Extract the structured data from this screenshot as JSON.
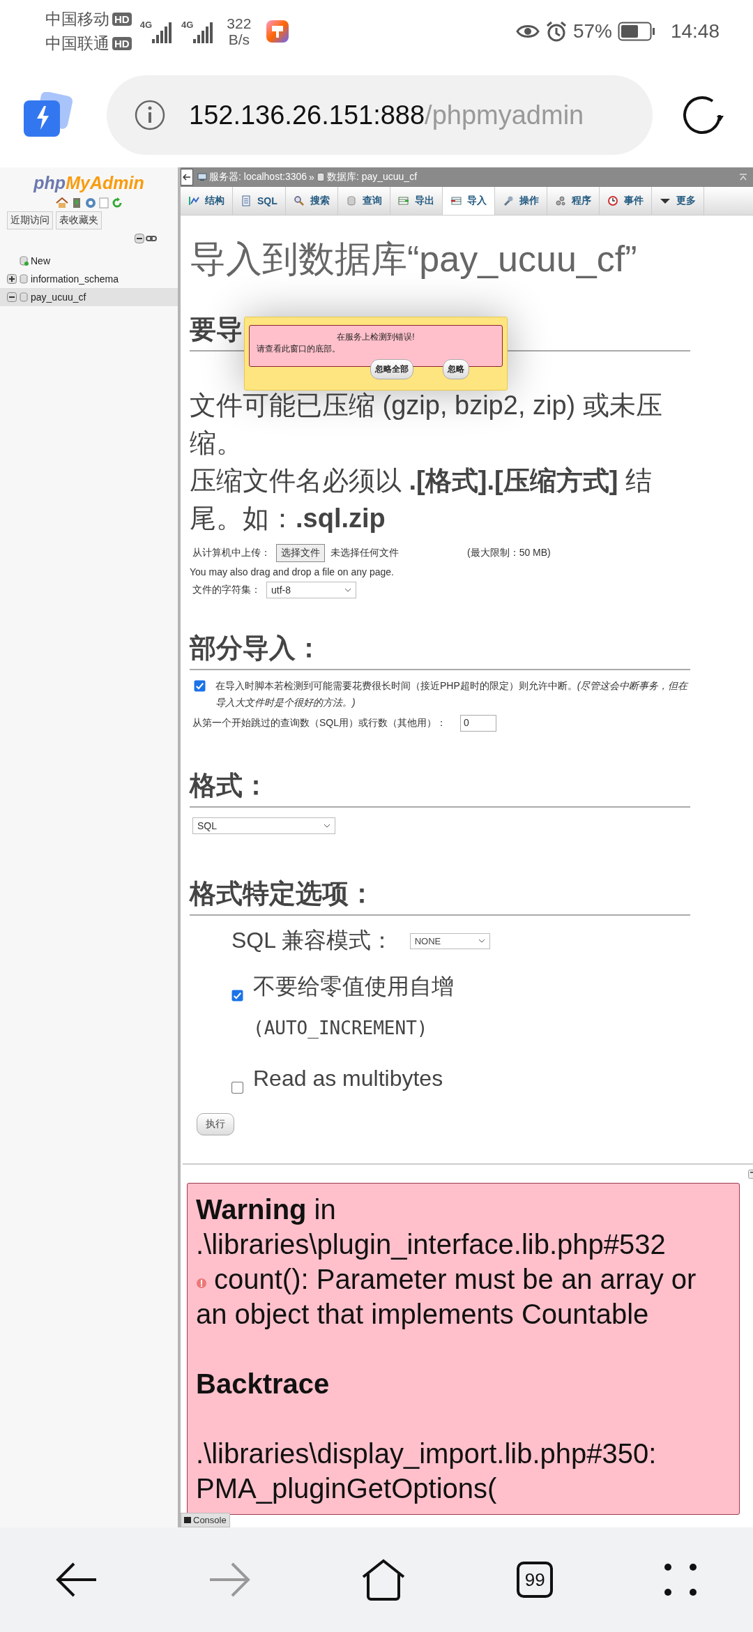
{
  "status_bar": {
    "carrier_1": "中国移动",
    "carrier_2": "中国联通",
    "hd_1": "HD",
    "hd_2": "HD",
    "network_1": "4G",
    "network_2": "4G",
    "speed": "322",
    "speed_unit": "B/s",
    "battery": "57%",
    "time": "14:48"
  },
  "url_bar": {
    "host": "152.136.26.151:888",
    "path": "/phpmyadmin"
  },
  "sidebar": {
    "logo_php": "php",
    "logo_myadmin": "MyAdmin",
    "buttons": [
      "近期访问",
      "表收藏夹"
    ],
    "tree": [
      {
        "kind": "new",
        "label": "New",
        "selected": false
      },
      {
        "kind": "database",
        "label": "information_schema",
        "expanded": false,
        "selected": false
      },
      {
        "kind": "database",
        "label": "pay_ucuu_cf",
        "expanded": true,
        "selected": true
      }
    ]
  },
  "breadcrumb": {
    "server": "服务器: localhost:3306",
    "separator": "»",
    "database": "数据库: pay_ucuu_cf"
  },
  "tabs": [
    {
      "label": "结构",
      "selected": false
    },
    {
      "label": "SQL",
      "selected": false
    },
    {
      "label": "搜索",
      "selected": false
    },
    {
      "label": "查询",
      "selected": false
    },
    {
      "label": "导出",
      "selected": false
    },
    {
      "label": "导入",
      "selected": true
    },
    {
      "label": "操作",
      "selected": false
    },
    {
      "label": "程序",
      "selected": false
    },
    {
      "label": "事件",
      "selected": false
    },
    {
      "label": "更多",
      "selected": false
    }
  ],
  "page_title": "导入到数据库“pay_ucuu_cf”",
  "file_section": {
    "heading": "要导",
    "compression_note": "文件可能已压缩 (gzip, bzip2, zip) 或未压缩。",
    "name_note": "压缩文件名必须以 **.[格式].[压缩方式]** 结尾。如：**.sql.zip**",
    "upload_label": "从计算机中上传：",
    "choose_button": "选择文件",
    "no_file": "未选择任何文件",
    "limit": "(最大限制：50 MB)",
    "drag_hint": "You may also drag and drop a file on any page.",
    "charset_label": "文件的字符集：",
    "charset_value": "utf-8"
  },
  "error_dialog": {
    "title": "在服务上检测到错误!",
    "message": "请查看此窗口的底部。",
    "buttons": [
      "忽略全部",
      "忽略"
    ]
  },
  "partial_section": {
    "heading": "部分导入：",
    "interrupt": {
      "text": "在导入时脚本若检测到可能需要花费很长时间（接近PHP超时的限定）则允许中断。*(尽管这会中断事务，但在导入大文件时是个很好的方法。)*",
      "checked": true
    },
    "skip_label": "从第一个开始跳过的查询数（SQL用）或行数（其他用）：",
    "skip_value": "0"
  },
  "format_section": {
    "heading": "格式：",
    "value": "SQL"
  },
  "options_section": {
    "heading": "格式特定选项：",
    "compat_label": "SQL 兼容模式：",
    "compat_value": "NONE",
    "options": [
      {
        "label": "不要给零值使用自增",
        "code": "(AUTO_INCREMENT)",
        "checked": true
      },
      {
        "label": "Read as multibytes",
        "checked": false
      }
    ]
  },
  "submit": "执行",
  "warning": {
    "message": "**Warning** in .\\libraries\\plugin_interface.lib.php#532",
    "detail": "count(): Parameter must be an array or an object that implements Countable",
    "backtrace_heading": "Backtrace",
    "trace_file": ".\\libraries\\display_import.lib.php#350:",
    "trace_call": "PMA_pluginGetOptions("
  },
  "console": "Console",
  "nav": {
    "tab_count": "99"
  }
}
